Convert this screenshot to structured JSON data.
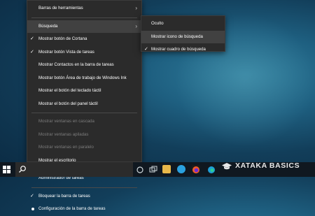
{
  "main_menu": {
    "items": [
      {
        "label": "Barras de herramientas",
        "submenu": true
      },
      {
        "label": "Búsqueda",
        "submenu": true,
        "highlighted": true
      },
      {
        "label": "Mostrar botón de Cortana",
        "checked": true
      },
      {
        "label": "Mostrar botón Vista de tareas",
        "checked": true
      },
      {
        "label": "Mostrar Contactos en la barra de tareas"
      },
      {
        "label": "Mostrar botón Área de trabajo de Windows Ink"
      },
      {
        "label": "Mostrar el botón del teclado táctil"
      },
      {
        "label": "Mostrar el botón del panel táctil"
      },
      {
        "label": "Mostrar ventanas en cascada",
        "disabled": true
      },
      {
        "label": "Mostrar ventanas apiladas",
        "disabled": true
      },
      {
        "label": "Mostrar ventanas en paralelo",
        "disabled": true
      },
      {
        "label": "Mostrar el escritorio"
      },
      {
        "label": "Administrador de tareas"
      },
      {
        "label": "Bloquear la barra de tareas",
        "checked": true
      },
      {
        "label": "Configuración de la barra de tareas",
        "bullet": true
      }
    ]
  },
  "sub_menu": {
    "items": [
      {
        "label": "Oculto"
      },
      {
        "label": "Mostrar icono de búsqueda",
        "highlighted": true
      },
      {
        "label": "Mostrar cuadro de búsqueda",
        "checked": true
      }
    ]
  },
  "glyphs": {
    "check": "✓",
    "arrow": "›"
  },
  "watermark": {
    "text": "XATAKA BASICS"
  },
  "colors": {
    "menu_bg": "#2b2b2b",
    "menu_highlight": "#414141",
    "taskbar_bg": "#101820",
    "disabled_text": "#7c7c7c"
  }
}
